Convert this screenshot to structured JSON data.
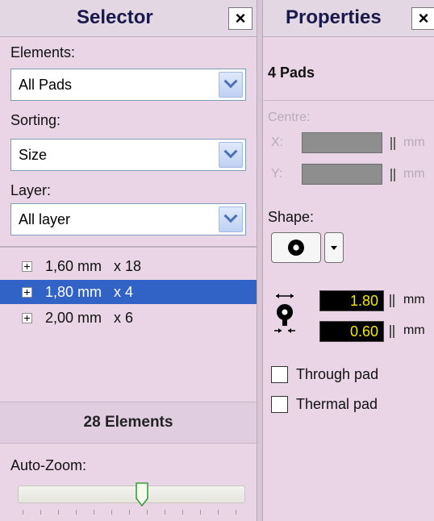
{
  "selector": {
    "title": "Selector",
    "close": "×",
    "elements_label": "Elements:",
    "elements_value": "All Pads",
    "sorting_label": "Sorting:",
    "sorting_value": "Size",
    "layer_label": "Layer:",
    "layer_value": "All layer",
    "items": [
      {
        "text": "1,60 mm   x 18",
        "selected": false
      },
      {
        "text": "1,80 mm   x 4",
        "selected": true
      },
      {
        "text": "2,00 mm   x 6",
        "selected": false
      }
    ],
    "count_text": "28 Elements",
    "autozoom_label": "Auto-Zoom:"
  },
  "properties": {
    "title": "Properties",
    "close": "×",
    "count": "4 Pads",
    "centre_label": "Centre:",
    "x_label": "X:",
    "y_label": "Y:",
    "unit_mm": "mm",
    "shape_label": "Shape:",
    "diameter_value": "1.80",
    "drill_value": "0.60",
    "through_pad_label": "Through pad",
    "thermal_pad_label": "Thermal pad"
  },
  "colors": {
    "panel_bg": "#e9d5e6",
    "selection": "#3162c5",
    "value_text": "#f3e600"
  }
}
